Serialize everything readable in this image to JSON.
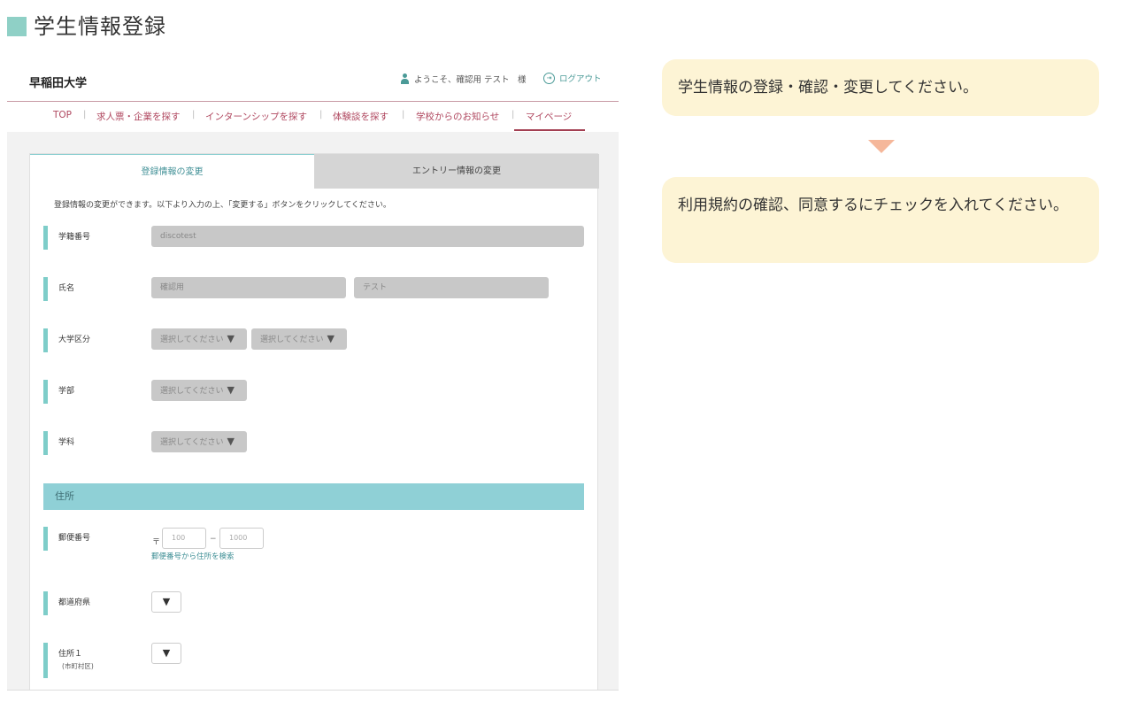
{
  "page_title": "学生情報登録",
  "header": {
    "logo": "早稲田大学",
    "welcome": "ようこそ、確認用 テスト　様",
    "logout": "ログアウト"
  },
  "nav": {
    "items": [
      {
        "label": "TOP"
      },
      {
        "label": "求人票・企業を探す"
      },
      {
        "label": "インターンシップを探す"
      },
      {
        "label": "体験談を探す"
      },
      {
        "label": "学校からのお知らせ"
      },
      {
        "label": "マイページ",
        "active": true
      }
    ]
  },
  "tabs": [
    {
      "label": "登録情報の変更",
      "active": true
    },
    {
      "label": "エントリー情報の変更",
      "active": false
    }
  ],
  "instruction": "登録情報の変更ができます。以下より入力の上、「変更する」ボタンをクリックしてください。",
  "form": {
    "student_id": {
      "label": "学籍番号",
      "value": "discotest"
    },
    "name": {
      "label": "氏名",
      "last": "確認用",
      "first": "テスト"
    },
    "university_type": {
      "label": "大学区分",
      "select1": "選択してください",
      "select2": "選択してください"
    },
    "faculty": {
      "label": "学部",
      "select": "選択してください"
    },
    "department": {
      "label": "学科",
      "select": "選択してください"
    },
    "address_section": "住所",
    "zip": {
      "label": "郵便番号",
      "mark": "〒",
      "first": "100",
      "second": "1000",
      "dash": "−",
      "search_link": "郵便番号から住所を検索"
    },
    "prefecture": {
      "label": "都道府県"
    },
    "address1": {
      "label": "住所１",
      "sublabel": "(市町村区)"
    }
  },
  "select_arrow": "▼",
  "bubbles": {
    "first": "学生情報の登録・確認・変更してください。",
    "second": "利用規約の確認、同意するにチェックを入れてください。"
  },
  "colors": {
    "accent_teal": "#8fd0c6",
    "nav_red": "#b04860",
    "bubble_bg": "#fdf4d5",
    "arrow": "#f5b79a"
  }
}
